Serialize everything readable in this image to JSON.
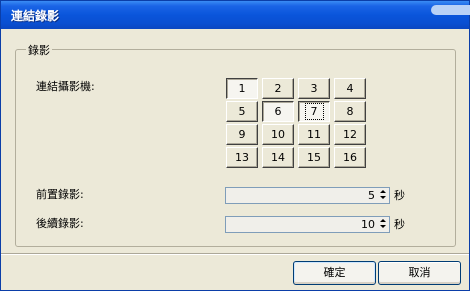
{
  "window": {
    "title": "連結錄影"
  },
  "group": {
    "legend": "錄影",
    "camera_label": "連結攝影機:",
    "cameras": [
      {
        "label": "1",
        "selected": true,
        "focused": false
      },
      {
        "label": "2",
        "selected": false,
        "focused": false
      },
      {
        "label": "3",
        "selected": false,
        "focused": false
      },
      {
        "label": "4",
        "selected": false,
        "focused": false
      },
      {
        "label": "5",
        "selected": false,
        "focused": false
      },
      {
        "label": "6",
        "selected": true,
        "focused": false
      },
      {
        "label": "7",
        "selected": true,
        "focused": true
      },
      {
        "label": "8",
        "selected": false,
        "focused": false
      },
      {
        "label": "9",
        "selected": false,
        "focused": false
      },
      {
        "label": "10",
        "selected": false,
        "focused": false
      },
      {
        "label": "11",
        "selected": false,
        "focused": false
      },
      {
        "label": "12",
        "selected": false,
        "focused": false
      },
      {
        "label": "13",
        "selected": false,
        "focused": false
      },
      {
        "label": "14",
        "selected": false,
        "focused": false
      },
      {
        "label": "15",
        "selected": false,
        "focused": false
      },
      {
        "label": "16",
        "selected": false,
        "focused": false
      }
    ],
    "pre_record": {
      "label": "前置錄影:",
      "value": "5",
      "unit": "秒"
    },
    "post_record": {
      "label": "後續錄影:",
      "value": "10",
      "unit": "秒"
    }
  },
  "buttons": {
    "ok": "確定",
    "cancel": "取消"
  }
}
